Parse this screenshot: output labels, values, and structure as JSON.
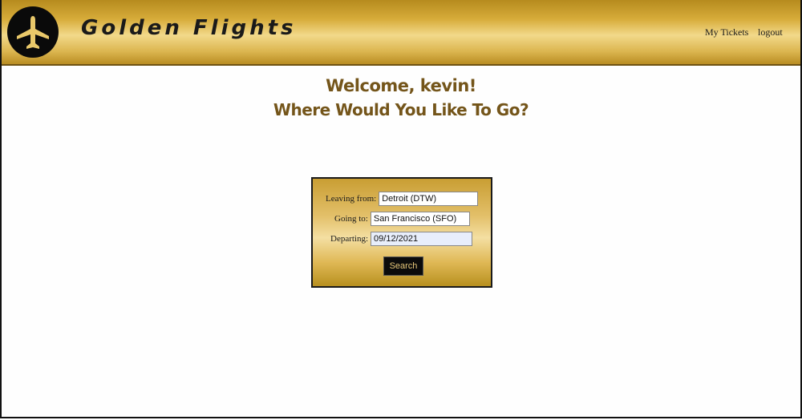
{
  "header": {
    "brand": "Golden Flights",
    "logo_icon": "airplane-icon",
    "nav": {
      "my_tickets": "My Tickets",
      "logout": "logout"
    }
  },
  "welcome": {
    "line1": "Welcome, kevin!",
    "line2": "Where Would You Like To Go?"
  },
  "search_form": {
    "leaving_from_label": "Leaving from:",
    "leaving_from_value": "Detroit (DTW)",
    "going_to_label": "Going to:",
    "going_to_value": "San Francisco (SFO)",
    "departing_label": "Departing:",
    "departing_value": "09/12/2021",
    "search_label": "Search"
  },
  "colors": {
    "gold_light": "#f2d98a",
    "gold_dark": "#b68b1e",
    "heading": "#74551a",
    "button_bg": "#0b0b0b",
    "button_text": "#e6c77a"
  }
}
